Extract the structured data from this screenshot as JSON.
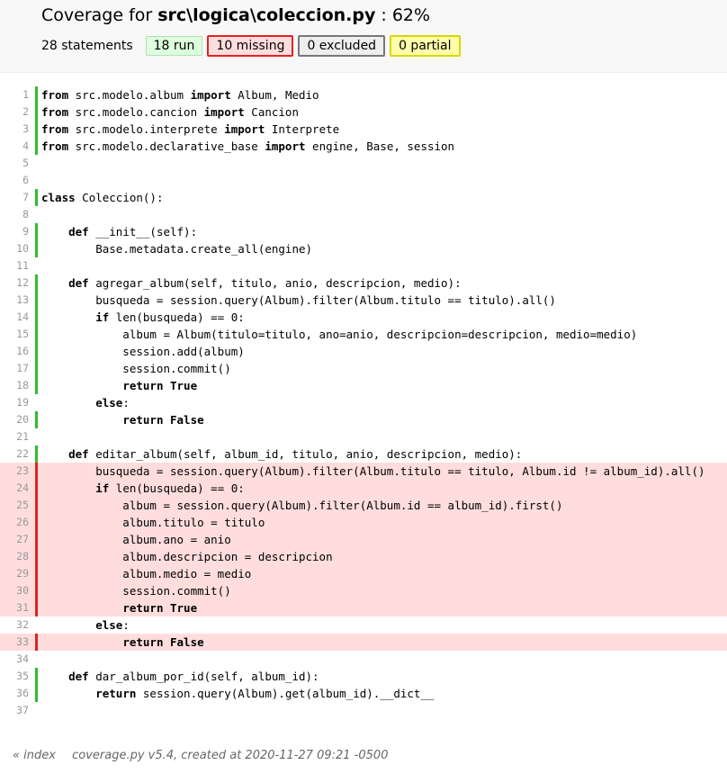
{
  "header": {
    "title_prefix": "Coverage for ",
    "file": "src\\logica\\coleccion.py",
    "title_suffix": " : 62%",
    "statements": "28 statements",
    "badges": {
      "run": "18 run",
      "missing": "10 missing",
      "excluded": "0 excluded",
      "partial": "0 partial"
    }
  },
  "colors": {
    "run_bar": "#33bb33",
    "missing_bar": "#dd2222",
    "missing_bg": "#ffdddd",
    "run_badge_bg": "#ddffdd",
    "partial_badge_bg": "#ffffaa"
  },
  "source_lines": [
    {
      "n": "1",
      "s": "run",
      "code": "<b>from</b> src.modelo.album <b>import</b> Album, Medio"
    },
    {
      "n": "2",
      "s": "run",
      "code": "<b>from</b> src.modelo.cancion <b>import</b> Cancion"
    },
    {
      "n": "3",
      "s": "run",
      "code": "<b>from</b> src.modelo.interprete <b>import</b> Interprete"
    },
    {
      "n": "4",
      "s": "run",
      "code": "<b>from</b> src.modelo.declarative_base <b>import</b> engine, Base, session"
    },
    {
      "n": "5",
      "s": "",
      "code": ""
    },
    {
      "n": "6",
      "s": "",
      "code": ""
    },
    {
      "n": "7",
      "s": "run",
      "code": "<b>class</b> Coleccion():"
    },
    {
      "n": "8",
      "s": "",
      "code": ""
    },
    {
      "n": "9",
      "s": "run",
      "code": "    <b>def</b> __init__(self):"
    },
    {
      "n": "10",
      "s": "run",
      "code": "        Base.metadata.create_all(engine)"
    },
    {
      "n": "11",
      "s": "",
      "code": ""
    },
    {
      "n": "12",
      "s": "run",
      "code": "    <b>def</b> agregar_album(self, titulo, anio, descripcion, medio):"
    },
    {
      "n": "13",
      "s": "run",
      "code": "        busqueda = session.query(Album).filter(Album.titulo == titulo).all()"
    },
    {
      "n": "14",
      "s": "run",
      "code": "        <b>if</b> len(busqueda) == 0:"
    },
    {
      "n": "15",
      "s": "run",
      "code": "            album = Album(titulo=titulo, ano=anio, descripcion=descripcion, medio=medio)"
    },
    {
      "n": "16",
      "s": "run",
      "code": "            session.add(album)"
    },
    {
      "n": "17",
      "s": "run",
      "code": "            session.commit()"
    },
    {
      "n": "18",
      "s": "run",
      "code": "            <b>return</b> <b>True</b>"
    },
    {
      "n": "19",
      "s": "",
      "code": "        <b>else</b>:"
    },
    {
      "n": "20",
      "s": "run",
      "code": "            <b>return</b> <b>False</b>"
    },
    {
      "n": "21",
      "s": "",
      "code": ""
    },
    {
      "n": "22",
      "s": "run",
      "code": "    <b>def</b> editar_album(self, album_id, titulo, anio, descripcion, medio):"
    },
    {
      "n": "23",
      "s": "mis",
      "code": "        busqueda = session.query(Album).filter(Album.titulo == titulo, Album.id != album_id).all()"
    },
    {
      "n": "24",
      "s": "mis",
      "code": "        <b>if</b> len(busqueda) == 0:"
    },
    {
      "n": "25",
      "s": "mis",
      "code": "            album = session.query(Album).filter(Album.id == album_id).first()"
    },
    {
      "n": "26",
      "s": "mis",
      "code": "            album.titulo = titulo"
    },
    {
      "n": "27",
      "s": "mis",
      "code": "            album.ano = anio"
    },
    {
      "n": "28",
      "s": "mis",
      "code": "            album.descripcion = descripcion"
    },
    {
      "n": "29",
      "s": "mis",
      "code": "            album.medio = medio"
    },
    {
      "n": "30",
      "s": "mis",
      "code": "            session.commit()"
    },
    {
      "n": "31",
      "s": "mis",
      "code": "            <b>return</b> <b>True</b>"
    },
    {
      "n": "32",
      "s": "",
      "code": "        <b>else</b>:"
    },
    {
      "n": "33",
      "s": "mis",
      "code": "            <b>return</b> <b>False</b>"
    },
    {
      "n": "34",
      "s": "",
      "code": ""
    },
    {
      "n": "35",
      "s": "run",
      "code": "    <b>def</b> dar_album_por_id(self, album_id):"
    },
    {
      "n": "36",
      "s": "run",
      "code": "        <b>return</b> session.query(Album).get(album_id).__dict__"
    },
    {
      "n": "37",
      "s": "",
      "code": ""
    }
  ],
  "footer": {
    "index_link": "« index",
    "created": "coverage.py v5.4, created at 2020-11-27 09:21 -0500"
  }
}
